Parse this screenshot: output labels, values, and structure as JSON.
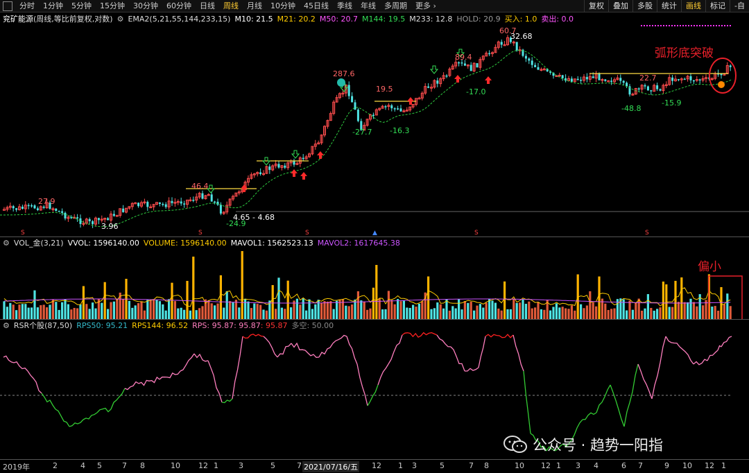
{
  "toolbar": {
    "tabs": [
      "分时",
      "1分钟",
      "5分钟",
      "15分钟",
      "30分钟",
      "60分钟",
      "日线",
      "周线",
      "月线",
      "10分钟",
      "45日线",
      "季线",
      "年线",
      "多周期",
      "更多 ›"
    ],
    "active_tab": "周线",
    "right_buttons": [
      "复权",
      "叠加",
      "多股",
      "统计",
      "画线",
      "标记",
      "-自"
    ],
    "active_right": "画线"
  },
  "main_legend": {
    "stock": "兖矿能源",
    "params": "(周线,等比前复权,对数)",
    "ema": "EMA2(5,21,55,144,233,15)",
    "m10": "M10: 21.5",
    "m21": "M21: 20.2",
    "m50": "M50: 20.7",
    "m144": "M144: 19.5",
    "m233": "M233: 12.8",
    "hold": "HOLD: 20.9",
    "buy": "买入: 1.0",
    "sell": "卖出: 0.0"
  },
  "price_labels": {
    "p279": "27.9",
    "p396": "3.96",
    "p464": "46.4",
    "p249": "-24.9",
    "range": "4.65 - 4.68",
    "p2876": "287.6",
    "p195": "19.5",
    "p277": "-27.7",
    "p163": "-16.3",
    "p894": "89.4",
    "p170": "-17.0",
    "p607": "60.7",
    "p3268": "32.68",
    "p227": "22.7",
    "p488": "-48.8",
    "p159": "-15.9"
  },
  "annotations": {
    "breakout": "弧形底突破",
    "small": "偏小"
  },
  "vol_legend": {
    "name": "VOL_金(3,21)",
    "vvol": "VVOL: 1596140.00",
    "volume": "VOLUME: 1596140.00",
    "mavol1": "MAVOL1: 1562523.13",
    "mavol2": "MAVOL2: 1617645.38"
  },
  "rsr_legend": {
    "name": "RSR个股(87,50)",
    "rps50": "RPS50: 95.21",
    "rps144": "RPS144: 96.52",
    "rps": "RPS: 95.87",
    "v1": ": 95.87",
    "v2": ": 95.87",
    "duokong": "多空: 50.00"
  },
  "xaxis": {
    "labels": [
      "2019年",
      "2",
      "4",
      "5",
      "7",
      "8",
      "10",
      "12",
      "1",
      "3",
      "5",
      "7",
      "2021/07/16/五",
      "12",
      "1",
      "3",
      "5",
      "7",
      "8",
      "10",
      "12",
      "1",
      "3",
      "4",
      "6",
      "7",
      "9",
      "10",
      "12",
      "1"
    ]
  },
  "watermark": {
    "text": "公众号 · 趋势一阳指"
  },
  "colors": {
    "up": "#ff4d4d",
    "down": "#4fe3e3",
    "accent_yellow": "#ffb300",
    "ma_green": "#2ecc40",
    "rsr_pink": "#ff7fbf",
    "rsr_red": "#ff2020",
    "annotation": "#e8202a"
  }
}
